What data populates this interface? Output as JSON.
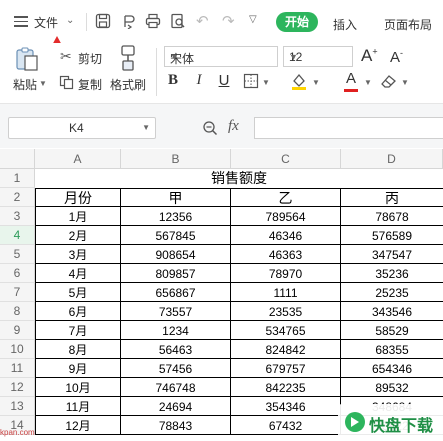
{
  "menu": {
    "file": "文件",
    "tabs": [
      "开始",
      "插入",
      "页面布局"
    ]
  },
  "ribbon": {
    "paste": "粘贴",
    "cut": "剪切",
    "copy": "复制",
    "format_painter": "格式刷",
    "font_name": "宋体",
    "font_size": "12",
    "bold": "B",
    "italic": "I",
    "underline": "U",
    "font_color_glyph": "A",
    "grow_font": "A",
    "shrink_font": "A"
  },
  "formula_bar": {
    "name_box": "K4",
    "fx": "fx",
    "formula": ""
  },
  "columns": [
    "A",
    "B",
    "C",
    "D"
  ],
  "selected_row": "4",
  "rows": [
    {
      "num": "1",
      "cells": [
        "",
        "",
        "销售额度",
        ""
      ]
    },
    {
      "num": "2",
      "cells": [
        "月份",
        "甲",
        "乙",
        "丙"
      ]
    },
    {
      "num": "3",
      "cells": [
        "1月",
        "12356",
        "789564",
        "78678"
      ]
    },
    {
      "num": "4",
      "cells": [
        "2月",
        "567845",
        "46346",
        "576589"
      ]
    },
    {
      "num": "5",
      "cells": [
        "3月",
        "908654",
        "46363",
        "347547"
      ]
    },
    {
      "num": "6",
      "cells": [
        "4月",
        "809857",
        "78970",
        "35236"
      ]
    },
    {
      "num": "7",
      "cells": [
        "5月",
        "656867",
        "1111",
        "25235"
      ]
    },
    {
      "num": "8",
      "cells": [
        "6月",
        "73557",
        "23535",
        "343546"
      ]
    },
    {
      "num": "9",
      "cells": [
        "7月",
        "1234",
        "534765",
        "58529"
      ]
    },
    {
      "num": "10",
      "cells": [
        "8月",
        "56463",
        "824842",
        "68355"
      ]
    },
    {
      "num": "11",
      "cells": [
        "9月",
        "57456",
        "679757",
        "654346"
      ]
    },
    {
      "num": "12",
      "cells": [
        "10月",
        "746748",
        "842235",
        "89532"
      ]
    },
    {
      "num": "13",
      "cells": [
        "11月",
        "24694",
        "354346",
        "348684"
      ]
    },
    {
      "num": "14",
      "cells": [
        "12月",
        "78843",
        "67432",
        "23522"
      ]
    }
  ],
  "watermark": {
    "text": "快盘下载",
    "side_text": "kpan.com"
  },
  "colors": {
    "accent": "#2db55d",
    "arrow": "#e32b2b",
    "font_color_bar": "#e02020",
    "fill_color_bar": "#ffd400"
  }
}
